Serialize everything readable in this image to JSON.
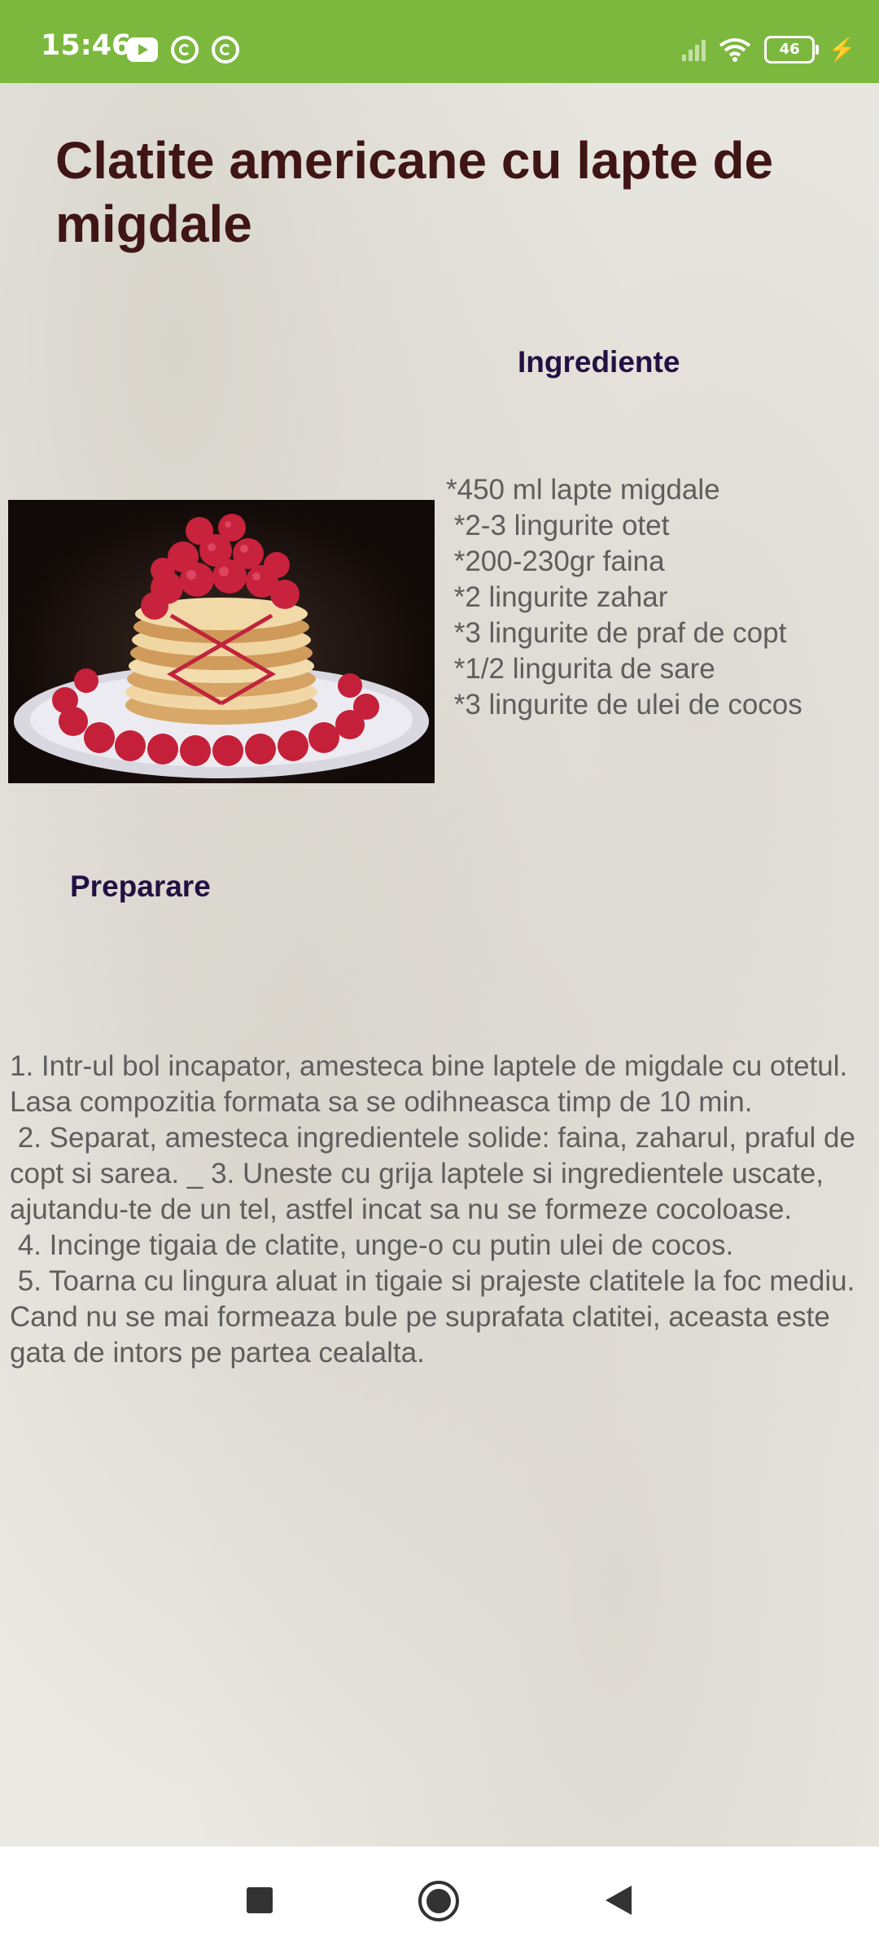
{
  "status_bar": {
    "time": "15:46",
    "battery": "46",
    "icons": [
      "youtube-icon",
      "app-notification-icon",
      "app-notification-icon",
      "signal-icon",
      "wifi-icon",
      "battery-icon",
      "charging-icon"
    ]
  },
  "recipe": {
    "title": "Clatite americane cu lapte de migdale",
    "ingredients_heading": "Ingrediente",
    "ingredients": "*450 ml lapte migdale\n *2-3 lingurite otet\n *200-230gr faina\n *2 lingurite zahar\n *3 lingurite de praf de copt\n *1/2 lingurita de sare\n *3 lingurite de ulei de cocos",
    "preparation_heading": "Preparare",
    "preparation": "1. Intr-ul bol incapator, amesteca bine laptele de migdale cu otetul. Lasa compozitia formata sa se odihneasca timp de 10 min.\n 2. Separat, amesteca ingredientele solide: faina, zaharul, praful de copt si sarea. _ 3. Uneste cu grija laptele si ingredientele uscate, ajutandu-te de un tel, astfel incat sa nu se formeze cocoloase.\n 4. Incinge tigaia de clatite, unge-o cu putin ulei de cocos.\n 5. Toarna cu lingura aluat in tigaie si prajeste clatitele la foc mediu. Cand nu se mai formeaza bule pe suprafata clatitei, aceasta este gata de intors pe partea cealalta."
  },
  "colors": {
    "status_bar": "#7cb83e",
    "title": "#3f1515",
    "heading": "#231043",
    "body_text": "#5e5e5e"
  },
  "nav_bar": {
    "icons": [
      "recents-icon",
      "home-icon",
      "back-icon"
    ]
  }
}
